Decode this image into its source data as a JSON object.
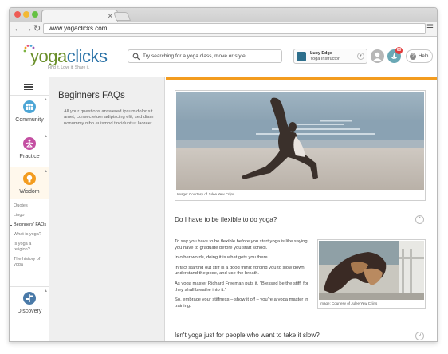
{
  "browser": {
    "url": "www.yogaclicks.com",
    "tab_close": "✕",
    "menu_icon": "☰"
  },
  "header": {
    "logo_yoga": "yoga",
    "logo_clicks": "clicks",
    "tagline": "Find it. Love it. Share it.",
    "search_placeholder": "Try searching for a yoga class, move or style",
    "profile_name": "Lucy Edge",
    "profile_role": "Yoga Instructor",
    "notification_count": "60",
    "help_label": "Help"
  },
  "nav": {
    "sections": [
      {
        "label": "Community",
        "icon": "community-icon",
        "color": "#4da6d6"
      },
      {
        "label": "Practice",
        "icon": "practice-icon",
        "color": "#c44fa2"
      },
      {
        "label": "Wisdom",
        "icon": "wisdom-icon",
        "color": "#f39c1f"
      },
      {
        "label": "Discovery",
        "icon": "discovery-icon",
        "color": "#4a7aa8"
      }
    ],
    "sublinks": [
      "Quotes",
      "Lingo",
      "Beginners' FAQs",
      "What is yoga?",
      "Is yoga a religion?",
      "The history of yoga"
    ]
  },
  "sidebar": {
    "title": "Beginners FAQs",
    "description": "All your questions answered ipsum dolor sit amet, consectetuer adipiscing elit, sed diam nonummy nibh euismod tincidunt ut laoreet ."
  },
  "content": {
    "hero_caption": "Image: Courtesy of Julee Yew Crijns",
    "faqs": [
      {
        "question": "Do I have to be flexible to do yoga?",
        "toggle": "^"
      },
      {
        "question": "Isn't yoga just for people who want to take it slow?",
        "toggle": "v"
      }
    ],
    "answer_paragraphs": [
      "To say you have to be flexible before you start yoga is like saying you have to graduate before you start school.",
      "In other words, doing it is what gets you there.",
      "In fact starting out stiff is a good thing; forcing you to slow down, understand the pose, and use the breath.",
      "As yoga master Richard Freeman puts it, \"Blessed be the stiff, for they shall breathe into it.\"",
      "So, embrace your stiffness – show it off – you're a yoga master in training."
    ],
    "photo2_caption": "Image: Courtesy of Julee Yew Crijns"
  },
  "colors": {
    "accent": "#f39c1f",
    "logo_green": "#6a8f2a",
    "logo_blue": "#2d74a8"
  }
}
